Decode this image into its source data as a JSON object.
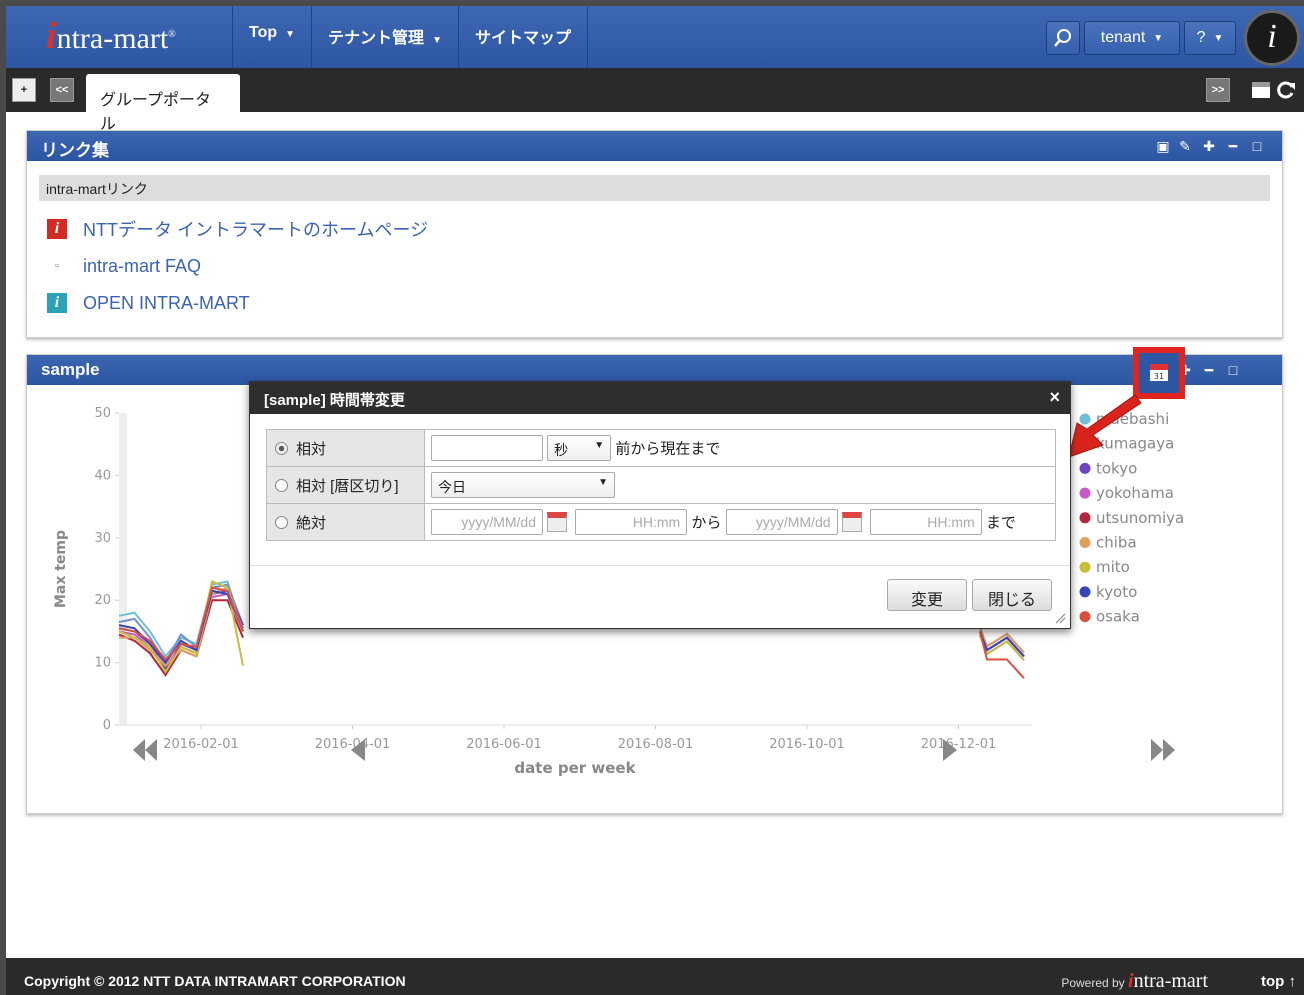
{
  "header": {
    "logo_text": "ntra-mart",
    "logo_i": "i",
    "nav": [
      {
        "label": "Top"
      },
      {
        "label": "テナント管理"
      },
      {
        "label": "サイトマップ"
      }
    ],
    "user": "tenant",
    "help": "?",
    "brand_glyph": "i"
  },
  "tabs": {
    "add": "+",
    "prev": "<<",
    "active": "グループポータル",
    "next": ">>"
  },
  "links_portlet": {
    "title": "リンク集",
    "group_header": "intra-martリンク",
    "links": [
      {
        "label": "NTTデータ イントラマートのホームページ",
        "icon": "intra-mart-red-icon"
      },
      {
        "label": "intra-mart FAQ",
        "icon": "square-outline-icon"
      },
      {
        "label": "OPEN INTRA-MART",
        "icon": "intra-mart-teal-icon"
      }
    ]
  },
  "sample_portlet": {
    "title": "sample"
  },
  "chart_data": {
    "type": "line",
    "title": "",
    "xlabel": "date per week",
    "ylabel": "Max temp",
    "ylim": [
      0,
      50
    ],
    "yticks": [
      "0",
      "10",
      "20",
      "30",
      "40",
      "50"
    ],
    "xticks": [
      "2016-02-01",
      "2016-04-01",
      "2016-06-01",
      "2016-08-01",
      "2016-10-01",
      "2016-12-01"
    ],
    "legend_position": "right",
    "series": [
      {
        "name": "maebashi",
        "color": "#6ec0d8",
        "values": [
          17.5,
          18,
          15,
          11,
          14,
          13,
          22.5,
          23,
          15
        ]
      },
      {
        "name": "kumagaya",
        "color": "#6f8ed8",
        "values": [
          16.5,
          17,
          14,
          10,
          14.5,
          12.5,
          22,
          22.5,
          16
        ]
      },
      {
        "name": "tokyo",
        "color": "#6b45c2",
        "values": [
          15.5,
          15,
          13,
          9,
          13,
          12,
          21,
          21.5,
          16
        ]
      },
      {
        "name": "yokohama",
        "color": "#c957c6",
        "values": [
          15,
          14.5,
          12.5,
          9.5,
          12.5,
          11.5,
          20.5,
          21,
          15.5
        ]
      },
      {
        "name": "utsunomiya",
        "color": "#b3263c",
        "values": [
          14.5,
          13.5,
          11.5,
          8,
          12,
          11,
          20,
          20,
          14
        ]
      },
      {
        "name": "chiba",
        "color": "#e0a060",
        "values": [
          14,
          14,
          12,
          9.5,
          12,
          11,
          21,
          22,
          15
        ]
      },
      {
        "name": "mito",
        "color": "#c7bf3a",
        "values": [
          15,
          14,
          12.5,
          8.5,
          12.5,
          11.5,
          23,
          22,
          9.5
        ]
      },
      {
        "name": "kyoto",
        "color": "#3646b8",
        "values": [
          16,
          15.5,
          13,
          10,
          13.5,
          12,
          21.5,
          21,
          15
        ]
      },
      {
        "name": "osaka",
        "color": "#d9503f",
        "values": [
          15.5,
          15,
          13.5,
          10.5,
          13,
          12.5,
          22,
          21.5,
          15
        ]
      }
    ],
    "tail_values": {
      "note_dates": [
        "2016-12-01"
      ],
      "osaka_tail": [
        15,
        10.5,
        10.5,
        7.5
      ],
      "others_tail": [
        15,
        12,
        14,
        11
      ]
    }
  },
  "dialog": {
    "title": "[sample] 時間帯変更",
    "close": "×",
    "rows": [
      {
        "label": "相対",
        "selected": true
      },
      {
        "label": "相対 [暦区切り]",
        "selected": false
      },
      {
        "label": "絶対",
        "selected": false
      }
    ],
    "relative_unit": "秒",
    "relative_suffix": "前から現在まで",
    "calendar_option": "今日",
    "date_placeholder": "yyyy/MM/dd",
    "time_placeholder": "HH:mm",
    "from_text": "から",
    "to_text": "まで",
    "change_button": "変更",
    "close_button": "閉じる"
  },
  "footer": {
    "copyright": "Copyright © 2012 NTT DATA INTRAMART CORPORATION",
    "powered_by": "Powered by",
    "brand_i": "i",
    "brand_text": "ntra-mart",
    "to_top": "top ↑"
  },
  "colors": {
    "header_blue": "#2d56a3",
    "highlight_red": "#e0251f",
    "link_blue": "#3a63b5"
  }
}
